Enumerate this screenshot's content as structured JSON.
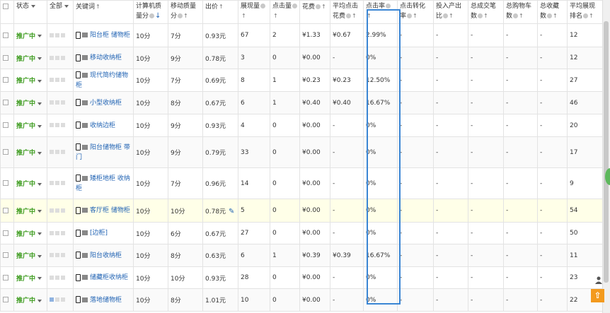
{
  "headers": {
    "status": "状态",
    "all": "全部",
    "keyword": "关键词",
    "pc_quality": "计算机质量分",
    "mobile_quality": "移动质量分",
    "bid": "出价",
    "impressions": "展现量",
    "clicks": "点击量",
    "cost": "花费",
    "avg_cpc": "平均点击花费",
    "ctr": "点击率",
    "cvr": "点击转化率",
    "roi": "投入产出比",
    "orders": "总成交笔数",
    "cart": "总购物车数",
    "fav": "总收藏数",
    "avg_rank": "平均展现排名"
  },
  "rows": [
    {
      "status": "推广中",
      "keyword": "阳台柜 储物柜",
      "pc": "10分",
      "mobile": "7分",
      "bid": "0.93元",
      "imp": "67",
      "clk": "2",
      "cost": "¥1.33",
      "cpc": "¥0.67",
      "ctr": "2.99%",
      "cvr": "-",
      "roi": "-",
      "orders": "-",
      "cart": "-",
      "fav": "-",
      "rank": "12"
    },
    {
      "status": "推广中",
      "keyword": "移动收纳柜",
      "pc": "10分",
      "mobile": "9分",
      "bid": "0.78元",
      "imp": "3",
      "clk": "0",
      "cost": "¥0.00",
      "cpc": "-",
      "ctr": "0%",
      "cvr": "-",
      "roi": "-",
      "orders": "-",
      "cart": "-",
      "fav": "-",
      "rank": "12"
    },
    {
      "status": "推广中",
      "keyword": "现代简约储物柜",
      "pc": "10分",
      "mobile": "7分",
      "bid": "0.69元",
      "imp": "8",
      "clk": "1",
      "cost": "¥0.23",
      "cpc": "¥0.23",
      "ctr": "12.50%",
      "cvr": "-",
      "roi": "-",
      "orders": "-",
      "cart": "-",
      "fav": "-",
      "rank": "27"
    },
    {
      "status": "推广中",
      "keyword": "小型收纳柜",
      "pc": "10分",
      "mobile": "8分",
      "bid": "0.67元",
      "imp": "6",
      "clk": "1",
      "cost": "¥0.40",
      "cpc": "¥0.40",
      "ctr": "16.67%",
      "cvr": "-",
      "roi": "-",
      "orders": "-",
      "cart": "-",
      "fav": "-",
      "rank": "46"
    },
    {
      "status": "推广中",
      "keyword": "收纳边柜",
      "pc": "10分",
      "mobile": "9分",
      "bid": "0.93元",
      "imp": "4",
      "clk": "0",
      "cost": "¥0.00",
      "cpc": "-",
      "ctr": "0%",
      "cvr": "-",
      "roi": "-",
      "orders": "-",
      "cart": "-",
      "fav": "-",
      "rank": "20"
    },
    {
      "status": "推广中",
      "keyword": "阳台储物柜 带门",
      "pc": "10分",
      "mobile": "9分",
      "bid": "0.79元",
      "imp": "33",
      "clk": "0",
      "cost": "¥0.00",
      "cpc": "-",
      "ctr": "0%",
      "cvr": "-",
      "roi": "-",
      "orders": "-",
      "cart": "-",
      "fav": "-",
      "rank": "17"
    },
    {
      "status": "推广中",
      "keyword": "矮柜地柜 收纳柜",
      "pc": "10分",
      "mobile": "7分",
      "bid": "0.96元",
      "imp": "14",
      "clk": "0",
      "cost": "¥0.00",
      "cpc": "-",
      "ctr": "0%",
      "cvr": "-",
      "roi": "-",
      "orders": "-",
      "cart": "-",
      "fav": "-",
      "rank": "9"
    },
    {
      "status": "推广中",
      "keyword": "客厅柜 储物柜",
      "pc": "10分",
      "mobile": "10分",
      "bid": "0.78元",
      "imp": "5",
      "clk": "0",
      "cost": "¥0.00",
      "cpc": "-",
      "ctr": "0%",
      "cvr": "-",
      "roi": "-",
      "orders": "-",
      "cart": "-",
      "fav": "-",
      "rank": "54",
      "highlight": true
    },
    {
      "status": "推广中",
      "keyword": "[边柜]",
      "pc": "10分",
      "mobile": "6分",
      "bid": "0.67元",
      "imp": "27",
      "clk": "0",
      "cost": "¥0.00",
      "cpc": "-",
      "ctr": "0%",
      "cvr": "-",
      "roi": "-",
      "orders": "-",
      "cart": "-",
      "fav": "-",
      "rank": "50"
    },
    {
      "status": "推广中",
      "keyword": "阳台收纳柜",
      "pc": "10分",
      "mobile": "8分",
      "bid": "0.63元",
      "imp": "6",
      "clk": "1",
      "cost": "¥0.39",
      "cpc": "¥0.39",
      "ctr": "16.67%",
      "cvr": "-",
      "roi": "-",
      "orders": "-",
      "cart": "-",
      "fav": "-",
      "rank": "11"
    },
    {
      "status": "推广中",
      "keyword": "储藏柜收纳柜",
      "pc": "10分",
      "mobile": "10分",
      "bid": "0.93元",
      "imp": "28",
      "clk": "0",
      "cost": "¥0.00",
      "cpc": "-",
      "ctr": "0%",
      "cvr": "-",
      "roi": "-",
      "orders": "-",
      "cart": "-",
      "fav": "-",
      "rank": "23"
    },
    {
      "status": "推广中",
      "keyword": "落地储物柜",
      "pc": "10分",
      "mobile": "8分",
      "bid": "1.01元",
      "imp": "10",
      "clk": "0",
      "cost": "¥0.00",
      "cpc": "-",
      "ctr": "0%",
      "cvr": "-",
      "roi": "-",
      "orders": "-",
      "cart": "-",
      "fav": "-",
      "rank": "22"
    }
  ],
  "colors": {
    "status": "#3a9a1b",
    "link": "#1f62b3",
    "highlight_box": "#3b86d4",
    "top_button": "#f39a1e"
  },
  "icons": {
    "sort": "sort-arrows-icon",
    "help": "help-icon",
    "device": "mobile-device-icon",
    "pc": "pc-icon",
    "edit": "edit-pencil-icon",
    "top": "back-to-top-icon"
  }
}
